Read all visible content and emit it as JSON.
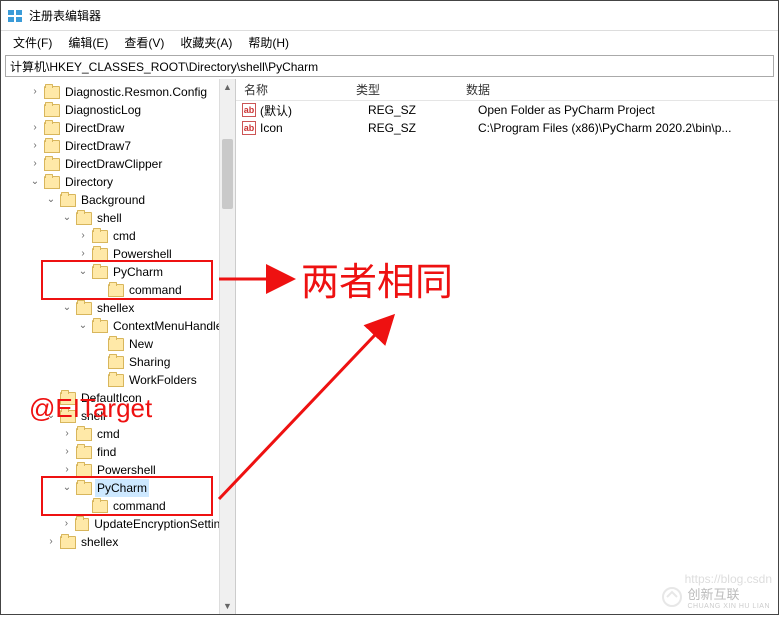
{
  "window": {
    "title": "注册表编辑器"
  },
  "menu": {
    "file": "文件(F)",
    "edit": "编辑(E)",
    "view": "查看(V)",
    "favorites": "收藏夹(A)",
    "help": "帮助(H)"
  },
  "path": "计算机\\HKEY_CLASSES_ROOT\\Directory\\shell\\PyCharm",
  "tree": {
    "n1": "Diagnostic.Resmon.Config",
    "n2": "DiagnosticLog",
    "n3": "DirectDraw",
    "n4": "DirectDraw7",
    "n5": "DirectDrawClipper",
    "n6": "Directory",
    "n7": "Background",
    "n8": "shell",
    "n9": "cmd",
    "n10": "Powershell",
    "n11": "PyCharm",
    "n12": "command",
    "n13": "shellex",
    "n14": "ContextMenuHandlers",
    "n15": "New",
    "n16": "Sharing",
    "n17": "WorkFolders",
    "n18": "DefaultIcon",
    "n19": "shell",
    "n20": "cmd",
    "n21": "find",
    "n22": "Powershell",
    "n23": "PyCharm",
    "n24": "command",
    "n25": "UpdateEncryptionSettings",
    "n26": "shellex"
  },
  "columns": {
    "name": "名称",
    "type": "类型",
    "data": "数据"
  },
  "rows": [
    {
      "name": "(默认)",
      "type": "REG_SZ",
      "data": "Open Folder as PyCharm Project"
    },
    {
      "name": "Icon",
      "type": "REG_SZ",
      "data": "C:\\Program Files (x86)\\PyCharm 2020.2\\bin\\p..."
    }
  ],
  "annotations": {
    "same": "两者相同",
    "at": "@EITarget",
    "wm": "https://blog.csdn",
    "logo1": "创新互联",
    "logo2": "CHUANG XIN HU LIAN"
  }
}
